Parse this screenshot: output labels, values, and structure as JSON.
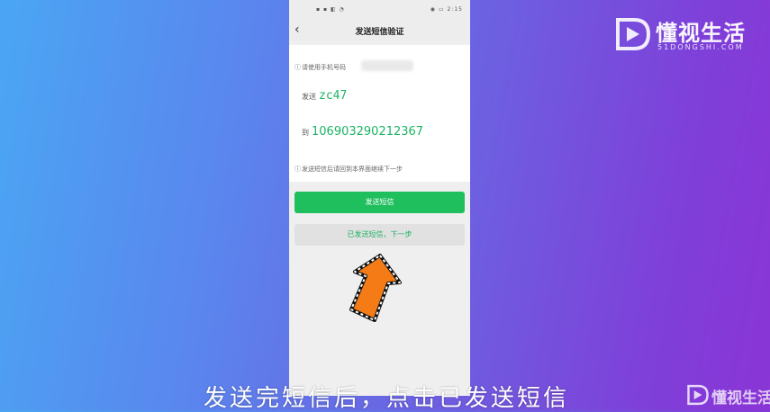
{
  "status_bar": {
    "left_icons": "▪ ▪ ◧ ◔",
    "right_icons": "◉ ▭ 2:15"
  },
  "nav": {
    "back_icon": "‹",
    "title": "发送短信验证"
  },
  "sms": {
    "hint_top": "请使用手机号码",
    "send_label": "发送",
    "code": "zc47",
    "to_label": "到",
    "number": "106903290212367",
    "hint_bottom": "发送短信后请回到本界面继续下一步"
  },
  "buttons": {
    "send_sms": "发送短信",
    "sent_next": "已发送短信，下一步"
  },
  "watermark": {
    "name": "懂视生活",
    "domain": "51DONGSHI.COM"
  },
  "caption": "发送完短信后，点击已发送短信",
  "colors": {
    "accent_green": "#1fbf5e",
    "arrow_orange": "#f47b16"
  },
  "icons": {
    "info": "info-icon",
    "back": "chevron-left-icon",
    "pointer": "arrow-up-icon"
  }
}
